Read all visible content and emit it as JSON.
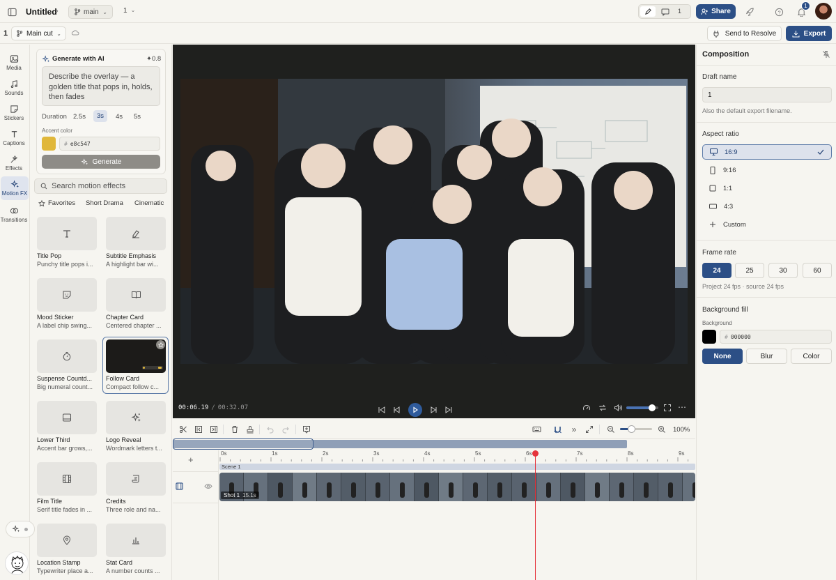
{
  "header": {
    "title": "Untitled",
    "branch": "main",
    "version": "1",
    "comment_count": "1",
    "share_label": "Share",
    "notification_count": "1"
  },
  "subbar": {
    "index": "1",
    "cut_name": "Main cut",
    "resolve_label": "Send to Resolve",
    "export_label": "Export"
  },
  "rail": [
    {
      "label": "Media",
      "icon": "image-icon"
    },
    {
      "label": "Sounds",
      "icon": "music-icon"
    },
    {
      "label": "Stickers",
      "icon": "sticker-icon"
    },
    {
      "label": "Captions",
      "icon": "text-icon"
    },
    {
      "label": "Effects",
      "icon": "wand-icon"
    },
    {
      "label": "Motion FX",
      "icon": "sparkles-icon",
      "active": true
    },
    {
      "label": "Transitions",
      "icon": "transition-icon"
    }
  ],
  "ai": {
    "title": "Generate with AI",
    "credits": "✦0.8",
    "prompt": "Describe the overlay — a golden title that pops in, holds, then fades",
    "duration_label": "Duration",
    "durations": [
      "2.5s",
      "3s",
      "4s",
      "5s"
    ],
    "selected_duration": "3s",
    "accent_label": "Accent color",
    "accent_hex": "e8c547",
    "accent_color": "#e0b73a",
    "generate_label": "Generate"
  },
  "search": {
    "placeholder": "Search motion effects"
  },
  "filters": [
    "Favorites",
    "Short Drama",
    "Cinematic"
  ],
  "effects": [
    {
      "title": "Title Pop",
      "desc": "Punchy title pops i...",
      "icon": "type-icon"
    },
    {
      "title": "Subtitle Emphasis",
      "desc": "A highlight bar wi...",
      "icon": "highlighter-icon"
    },
    {
      "title": "Mood Sticker",
      "desc": "A label chip swing...",
      "icon": "smile-sticker-icon"
    },
    {
      "title": "Chapter Card",
      "desc": "Centered chapter ...",
      "icon": "book-icon"
    },
    {
      "title": "Suspense Countd...",
      "desc": "Big numeral count...",
      "icon": "timer-icon"
    },
    {
      "title": "Follow Card",
      "desc": "Compact follow c...",
      "icon": "follow-card-preview",
      "selected": true
    },
    {
      "title": "Lower Third",
      "desc": "Accent bar grows,...",
      "icon": "lower-third-icon"
    },
    {
      "title": "Logo Reveal",
      "desc": "Wordmark letters t...",
      "icon": "sparkles-icon"
    },
    {
      "title": "Film Title",
      "desc": "Serif title fades in ...",
      "icon": "film-icon"
    },
    {
      "title": "Credits",
      "desc": "Three role and na...",
      "icon": "scroll-icon"
    },
    {
      "title": "Location Stamp",
      "desc": "Typewriter place a...",
      "icon": "map-pin-icon"
    },
    {
      "title": "Stat Card",
      "desc": "A number counts ...",
      "icon": "bar-chart-icon"
    }
  ],
  "player": {
    "current_time": "00:06.19",
    "separator": "/",
    "total_time": "00:32.07",
    "volume": 0.8
  },
  "timeline": {
    "zoom": "100%",
    "ticks": [
      "0s",
      "1s",
      "2s",
      "3s",
      "4s",
      "5s",
      "6s",
      "7s",
      "8s",
      "9s"
    ],
    "scene_label": "Scene 1",
    "clip_label": "Shot 1",
    "clip_duration": "15.1s",
    "playhead_seconds": 6.19
  },
  "composition": {
    "title": "Composition",
    "draft_label": "Draft name",
    "draft_value": "1",
    "draft_hint": "Also the default export filename.",
    "aspect_label": "Aspect ratio",
    "aspects": [
      {
        "label": "16:9",
        "icon": "monitor-icon",
        "selected": true
      },
      {
        "label": "9:16",
        "icon": "phone-icon"
      },
      {
        "label": "1:1",
        "icon": "square-icon"
      },
      {
        "label": "4:3",
        "icon": "rect-icon"
      },
      {
        "label": "Custom",
        "icon": "plus-icon"
      }
    ],
    "fps_label": "Frame rate",
    "fps": [
      "24",
      "25",
      "30",
      "60"
    ],
    "fps_selected": "24",
    "fps_hint": "Project 24 fps · source 24 fps",
    "bg_label": "Background fill",
    "bg_sub": "Background",
    "bg_hex": "000000",
    "bg_color": "#000000",
    "fills": [
      "None",
      "Blur",
      "Color"
    ],
    "fill_selected": "None"
  },
  "colors": {
    "accent": "#2c4f86",
    "playhead": "#e5333b",
    "panel_bg": "#f6f5f0"
  }
}
